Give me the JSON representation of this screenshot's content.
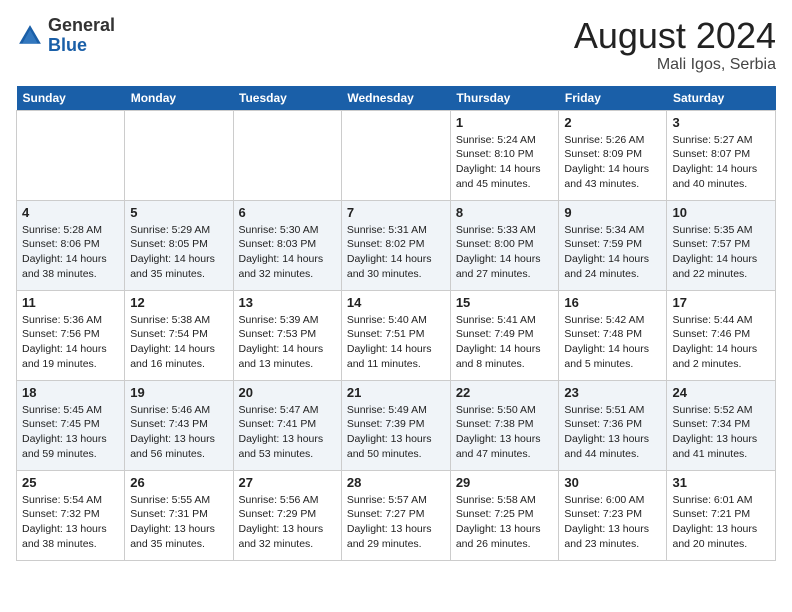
{
  "header": {
    "logo_general": "General",
    "logo_blue": "Blue",
    "month_title": "August 2024",
    "location": "Mali Igos, Serbia"
  },
  "days_of_week": [
    "Sunday",
    "Monday",
    "Tuesday",
    "Wednesday",
    "Thursday",
    "Friday",
    "Saturday"
  ],
  "weeks": [
    [
      {
        "day": "",
        "content": ""
      },
      {
        "day": "",
        "content": ""
      },
      {
        "day": "",
        "content": ""
      },
      {
        "day": "",
        "content": ""
      },
      {
        "day": "1",
        "content": "Sunrise: 5:24 AM\nSunset: 8:10 PM\nDaylight: 14 hours\nand 45 minutes."
      },
      {
        "day": "2",
        "content": "Sunrise: 5:26 AM\nSunset: 8:09 PM\nDaylight: 14 hours\nand 43 minutes."
      },
      {
        "day": "3",
        "content": "Sunrise: 5:27 AM\nSunset: 8:07 PM\nDaylight: 14 hours\nand 40 minutes."
      }
    ],
    [
      {
        "day": "4",
        "content": "Sunrise: 5:28 AM\nSunset: 8:06 PM\nDaylight: 14 hours\nand 38 minutes."
      },
      {
        "day": "5",
        "content": "Sunrise: 5:29 AM\nSunset: 8:05 PM\nDaylight: 14 hours\nand 35 minutes."
      },
      {
        "day": "6",
        "content": "Sunrise: 5:30 AM\nSunset: 8:03 PM\nDaylight: 14 hours\nand 32 minutes."
      },
      {
        "day": "7",
        "content": "Sunrise: 5:31 AM\nSunset: 8:02 PM\nDaylight: 14 hours\nand 30 minutes."
      },
      {
        "day": "8",
        "content": "Sunrise: 5:33 AM\nSunset: 8:00 PM\nDaylight: 14 hours\nand 27 minutes."
      },
      {
        "day": "9",
        "content": "Sunrise: 5:34 AM\nSunset: 7:59 PM\nDaylight: 14 hours\nand 24 minutes."
      },
      {
        "day": "10",
        "content": "Sunrise: 5:35 AM\nSunset: 7:57 PM\nDaylight: 14 hours\nand 22 minutes."
      }
    ],
    [
      {
        "day": "11",
        "content": "Sunrise: 5:36 AM\nSunset: 7:56 PM\nDaylight: 14 hours\nand 19 minutes."
      },
      {
        "day": "12",
        "content": "Sunrise: 5:38 AM\nSunset: 7:54 PM\nDaylight: 14 hours\nand 16 minutes."
      },
      {
        "day": "13",
        "content": "Sunrise: 5:39 AM\nSunset: 7:53 PM\nDaylight: 14 hours\nand 13 minutes."
      },
      {
        "day": "14",
        "content": "Sunrise: 5:40 AM\nSunset: 7:51 PM\nDaylight: 14 hours\nand 11 minutes."
      },
      {
        "day": "15",
        "content": "Sunrise: 5:41 AM\nSunset: 7:49 PM\nDaylight: 14 hours\nand 8 minutes."
      },
      {
        "day": "16",
        "content": "Sunrise: 5:42 AM\nSunset: 7:48 PM\nDaylight: 14 hours\nand 5 minutes."
      },
      {
        "day": "17",
        "content": "Sunrise: 5:44 AM\nSunset: 7:46 PM\nDaylight: 14 hours\nand 2 minutes."
      }
    ],
    [
      {
        "day": "18",
        "content": "Sunrise: 5:45 AM\nSunset: 7:45 PM\nDaylight: 13 hours\nand 59 minutes."
      },
      {
        "day": "19",
        "content": "Sunrise: 5:46 AM\nSunset: 7:43 PM\nDaylight: 13 hours\nand 56 minutes."
      },
      {
        "day": "20",
        "content": "Sunrise: 5:47 AM\nSunset: 7:41 PM\nDaylight: 13 hours\nand 53 minutes."
      },
      {
        "day": "21",
        "content": "Sunrise: 5:49 AM\nSunset: 7:39 PM\nDaylight: 13 hours\nand 50 minutes."
      },
      {
        "day": "22",
        "content": "Sunrise: 5:50 AM\nSunset: 7:38 PM\nDaylight: 13 hours\nand 47 minutes."
      },
      {
        "day": "23",
        "content": "Sunrise: 5:51 AM\nSunset: 7:36 PM\nDaylight: 13 hours\nand 44 minutes."
      },
      {
        "day": "24",
        "content": "Sunrise: 5:52 AM\nSunset: 7:34 PM\nDaylight: 13 hours\nand 41 minutes."
      }
    ],
    [
      {
        "day": "25",
        "content": "Sunrise: 5:54 AM\nSunset: 7:32 PM\nDaylight: 13 hours\nand 38 minutes."
      },
      {
        "day": "26",
        "content": "Sunrise: 5:55 AM\nSunset: 7:31 PM\nDaylight: 13 hours\nand 35 minutes."
      },
      {
        "day": "27",
        "content": "Sunrise: 5:56 AM\nSunset: 7:29 PM\nDaylight: 13 hours\nand 32 minutes."
      },
      {
        "day": "28",
        "content": "Sunrise: 5:57 AM\nSunset: 7:27 PM\nDaylight: 13 hours\nand 29 minutes."
      },
      {
        "day": "29",
        "content": "Sunrise: 5:58 AM\nSunset: 7:25 PM\nDaylight: 13 hours\nand 26 minutes."
      },
      {
        "day": "30",
        "content": "Sunrise: 6:00 AM\nSunset: 7:23 PM\nDaylight: 13 hours\nand 23 minutes."
      },
      {
        "day": "31",
        "content": "Sunrise: 6:01 AM\nSunset: 7:21 PM\nDaylight: 13 hours\nand 20 minutes."
      }
    ]
  ]
}
